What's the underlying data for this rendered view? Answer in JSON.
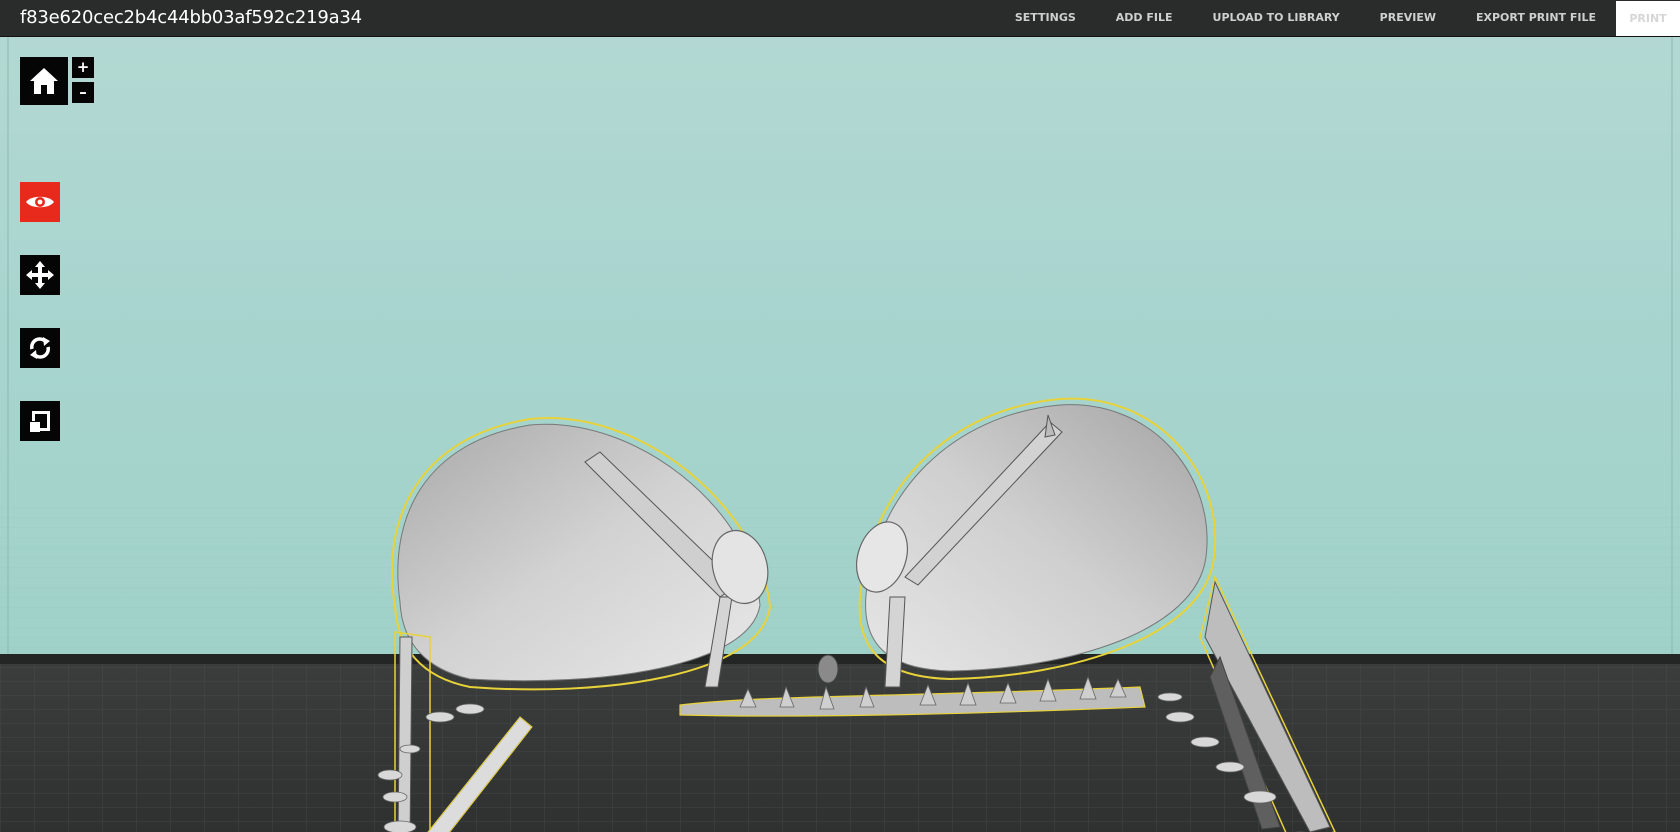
{
  "header": {
    "file_name": "f83e620cec2b4c44bb03af592c219a34",
    "menu": {
      "settings": "SETTINGS",
      "add_file": "ADD FILE",
      "upload_to_library": "UPLOAD TO LIBRARY",
      "preview": "PREVIEW",
      "export_print_file": "EXPORT PRINT FILE",
      "print": "PRINT"
    }
  },
  "toolbar": {
    "home_icon": "home-icon",
    "zoom_in_label": "+",
    "zoom_out_label": "–",
    "tools": [
      {
        "name": "view",
        "icon": "eye-icon",
        "active": true
      },
      {
        "name": "move",
        "icon": "move-arrows-icon",
        "active": false
      },
      {
        "name": "rotate",
        "icon": "rotate-icon",
        "active": false
      },
      {
        "name": "scale",
        "icon": "scale-icon",
        "active": false
      }
    ]
  },
  "colors": {
    "topbar": "#2a2c2c",
    "active_tool": "#e82a1c",
    "tool": "#050505",
    "background": "#a7d4ce",
    "build_plate": "#3a3c3c",
    "model": "#d8d8d8",
    "outline": "#e8d23a"
  }
}
